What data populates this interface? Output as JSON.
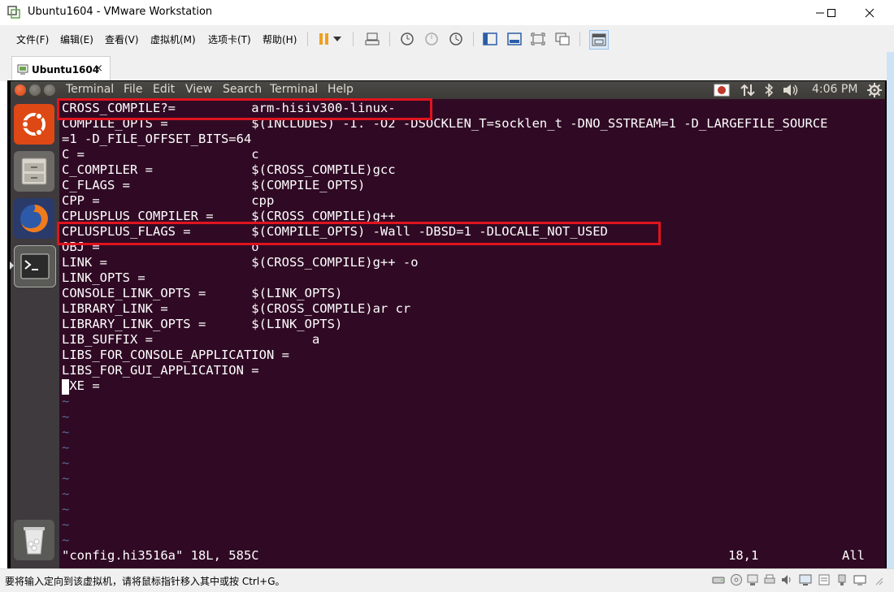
{
  "window": {
    "title": "Ubuntu1604 - VMware Workstation",
    "minimize_glyph": "—",
    "maximize_glyph": "☐",
    "close_glyph": "✕"
  },
  "menubar": {
    "items": [
      "文件(F)",
      "编辑(E)",
      "查看(V)",
      "虚拟机(M)",
      "选项卡(T)",
      "帮助(H)"
    ]
  },
  "toolbar": {
    "icons": [
      "pause-icon",
      "dropdown-arrow-icon",
      "send-ctrl-alt-del-icon",
      "snapshot-take-icon",
      "snapshot-revert-icon",
      "snapshot-manager-icon",
      "view-library-icon",
      "view-console-icon",
      "full-screen-icon",
      "unity-icon",
      "thumbnail-view-icon"
    ]
  },
  "tab": {
    "label": "Ubuntu1604",
    "close_glyph": "×"
  },
  "ubuntu_panel": {
    "menus": [
      "Terminal",
      "File",
      "Edit",
      "View",
      "Search",
      "Terminal",
      "Help"
    ],
    "clock": "4:06 PM"
  },
  "terminal": {
    "lines": [
      "CROSS_COMPILE?=          arm-hisiv300-linux-",
      "COMPILE_OPTS =           $(INCLUDES) -I. -O2 -DSOCKLEN_T=socklen_t -DNO_SSTREAM=1 -D_LARGEFILE_SOURCE",
      "=1 -D_FILE_OFFSET_BITS=64",
      "C =                      c",
      "C_COMPILER =             $(CROSS_COMPILE)gcc",
      "C_FLAGS =                $(COMPILE_OPTS)",
      "CPP =                    cpp",
      "CPLUSPLUS_COMPILER =     $(CROSS_COMPILE)g++",
      "CPLUSPLUS_FLAGS =        $(COMPILE_OPTS) -Wall -DBSD=1 -DLOCALE_NOT_USED",
      "OBJ =                    o",
      "LINK =                   $(CROSS_COMPILE)g++ -o",
      "LINK_OPTS =",
      "CONSOLE_LINK_OPTS =      $(LINK_OPTS)",
      "LIBRARY_LINK =           $(CROSS_COMPILE)ar cr",
      "LIBRARY_LINK_OPTS =      $(LINK_OPTS)",
      "LIB_SUFFIX =                     a",
      "LIBS_FOR_CONSOLE_APPLICATION =",
      "LIBS_FOR_GUI_APPLICATION =",
      "EXE ="
    ],
    "tilde": "~",
    "tilde_count": 10,
    "status_file": "\"config.hi3516a\" 18L, 585C",
    "status_pos": "18,1",
    "status_scroll": "All"
  },
  "statusbar": {
    "message": "要将输入定向到该虚拟机，请将鼠标指针移入其中或按 Ctrl+G。"
  },
  "colors": {
    "terminal_bg": "#300a24",
    "highlight": "#e0141e",
    "panel_bg": "#3c3b37",
    "launcher_bg": "#3f3a3e"
  }
}
